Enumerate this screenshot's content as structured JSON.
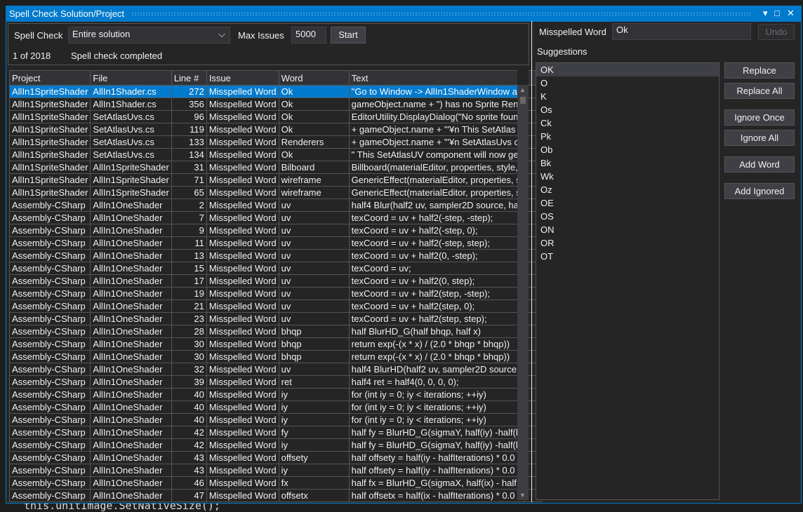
{
  "background_code": "this.unitImage.SetNativeSize();",
  "window": {
    "title": "Spell Check Solution/Project",
    "controls": {
      "dropdown": "▾",
      "maximize": "□",
      "close": "✕"
    }
  },
  "toolbar": {
    "spell_check_label": "Spell Check",
    "scope": "Entire solution",
    "max_issues_label": "Max Issues",
    "max_issues": "5000",
    "start": "Start",
    "position": "1 of 2018",
    "status": "Spell check completed"
  },
  "table": {
    "columns": [
      "Project",
      "File",
      "Line #",
      "Issue",
      "Word",
      "Text"
    ],
    "rows": [
      [
        "AllIn1SpriteShader",
        "AllIn1Shader.cs",
        "272",
        "Misspelled Word",
        "Ok",
        "\"Go to Window -> AllIn1ShaderWindow an"
      ],
      [
        "AllIn1SpriteShader",
        "AllIn1Shader.cs",
        "356",
        "Misspelled Word",
        "Ok",
        "gameObject.name + \") has no Sprite Ren"
      ],
      [
        "AllIn1SpriteShader",
        "SetAtlasUvs.cs",
        "96",
        "Misspelled Word",
        "Ok",
        "EditorUtility.DisplayDialog(\"No sprite foun"
      ],
      [
        "AllIn1SpriteShader",
        "SetAtlasUvs.cs",
        "119",
        "Misspelled Word",
        "Ok",
        "+ gameObject.name + \"'¥n This SetAtlas"
      ],
      [
        "AllIn1SpriteShader",
        "SetAtlasUvs.cs",
        "133",
        "Misspelled Word",
        "Renderers",
        "+ gameObject.name + \"'¥n SetAtlasUvs c"
      ],
      [
        "AllIn1SpriteShader",
        "SetAtlasUvs.cs",
        "134",
        "Misspelled Word",
        "Ok",
        "\" This SetAtlasUV component will now get"
      ],
      [
        "AllIn1SpriteShader",
        "AllIn1SpriteShader",
        "31",
        "Misspelled Word",
        "Bilboard",
        "Billboard(materialEditor, properties, style,"
      ],
      [
        "AllIn1SpriteShader",
        "AllIn1SpriteShader",
        "71",
        "Misspelled Word",
        "wireframe",
        "GenericEffect(materialEditor, properties, s"
      ],
      [
        "AllIn1SpriteShader",
        "AllIn1SpriteShader",
        "65",
        "Misspelled Word",
        "wireframe",
        "GenericEffect(materialEditor, properties, s"
      ],
      [
        "Assembly-CSharp",
        "AllIn1OneShader",
        "2",
        "Misspelled Word",
        "uv",
        "half4 Blur(half2 uv, sampler2D source, hal"
      ],
      [
        "Assembly-CSharp",
        "AllIn1OneShader",
        "7",
        "Misspelled Word",
        "uv",
        "texCoord = uv + half2(-step, -step);"
      ],
      [
        "Assembly-CSharp",
        "AllIn1OneShader",
        "9",
        "Misspelled Word",
        "uv",
        "texCoord = uv + half2(-step, 0);"
      ],
      [
        "Assembly-CSharp",
        "AllIn1OneShader",
        "11",
        "Misspelled Word",
        "uv",
        "texCoord = uv + half2(-step, step);"
      ],
      [
        "Assembly-CSharp",
        "AllIn1OneShader",
        "13",
        "Misspelled Word",
        "uv",
        "texCoord = uv + half2(0, -step);"
      ],
      [
        "Assembly-CSharp",
        "AllIn1OneShader",
        "15",
        "Misspelled Word",
        "uv",
        "texCoord = uv;"
      ],
      [
        "Assembly-CSharp",
        "AllIn1OneShader",
        "17",
        "Misspelled Word",
        "uv",
        "texCoord = uv + half2(0, step);"
      ],
      [
        "Assembly-CSharp",
        "AllIn1OneShader",
        "19",
        "Misspelled Word",
        "uv",
        "texCoord = uv + half2(step, -step);"
      ],
      [
        "Assembly-CSharp",
        "AllIn1OneShader",
        "21",
        "Misspelled Word",
        "uv",
        "texCoord = uv + half2(step, 0);"
      ],
      [
        "Assembly-CSharp",
        "AllIn1OneShader",
        "23",
        "Misspelled Word",
        "uv",
        "texCoord = uv + half2(step, step);"
      ],
      [
        "Assembly-CSharp",
        "AllIn1OneShader",
        "28",
        "Misspelled Word",
        "bhqp",
        "half BlurHD_G(half bhqp, half x)"
      ],
      [
        "Assembly-CSharp",
        "AllIn1OneShader",
        "30",
        "Misspelled Word",
        "bhqp",
        "return exp(-(x * x) / (2.0 * bhqp * bhqp))"
      ],
      [
        "Assembly-CSharp",
        "AllIn1OneShader",
        "30",
        "Misspelled Word",
        "bhqp",
        "return exp(-(x * x) / (2.0 * bhqp * bhqp))"
      ],
      [
        "Assembly-CSharp",
        "AllIn1OneShader",
        "32",
        "Misspelled Word",
        "uv",
        "half4 BlurHD(half2 uv, sampler2D source,"
      ],
      [
        "Assembly-CSharp",
        "AllIn1OneShader",
        "39",
        "Misspelled Word",
        "ret",
        "half4 ret = half4(0, 0, 0, 0);"
      ],
      [
        "Assembly-CSharp",
        "AllIn1OneShader",
        "40",
        "Misspelled Word",
        "iy",
        "for (int iy = 0; iy < iterations; ++iy)"
      ],
      [
        "Assembly-CSharp",
        "AllIn1OneShader",
        "40",
        "Misspelled Word",
        "iy",
        "for (int iy = 0; iy < iterations; ++iy)"
      ],
      [
        "Assembly-CSharp",
        "AllIn1OneShader",
        "40",
        "Misspelled Word",
        "iy",
        "for (int iy = 0; iy < iterations; ++iy)"
      ],
      [
        "Assembly-CSharp",
        "AllIn1OneShader",
        "42",
        "Misspelled Word",
        "fy",
        "half fy = BlurHD_G(sigmaY, half(iy) -half(l"
      ],
      [
        "Assembly-CSharp",
        "AllIn1OneShader",
        "42",
        "Misspelled Word",
        "iy",
        "half fy = BlurHD_G(sigmaY, half(iy) -half(l"
      ],
      [
        "Assembly-CSharp",
        "AllIn1OneShader",
        "43",
        "Misspelled Word",
        "offsety",
        "half offsety = half(iy - halfIterations) * 0.0"
      ],
      [
        "Assembly-CSharp",
        "AllIn1OneShader",
        "43",
        "Misspelled Word",
        "iy",
        "half offsety = half(iy - halfIterations) * 0.0"
      ],
      [
        "Assembly-CSharp",
        "AllIn1OneShader",
        "46",
        "Misspelled Word",
        "fx",
        "half fx = BlurHD_G(sigmaX, half(ix) - half"
      ],
      [
        "Assembly-CSharp",
        "AllIn1OneShader",
        "47",
        "Misspelled Word",
        "offsetx",
        "half offsetx = half(ix - halfIterations) * 0.0"
      ]
    ],
    "selected_row": 0
  },
  "right": {
    "misspelled_label": "Misspelled Word",
    "misspelled_value": "Ok",
    "undo": "Undo",
    "suggestions_label": "Suggestions",
    "suggestions": [
      "OK",
      "O",
      "K",
      "Os",
      "Ck",
      "Pk",
      "Ob",
      "Bk",
      "Wk",
      "Oz",
      "OE",
      "OS",
      "ON",
      "OR",
      "OT"
    ],
    "buttons": [
      "Replace",
      "Replace All",
      "Ignore Once",
      "Ignore All",
      "Add Word",
      "Add Ignored"
    ]
  },
  "colors": {
    "accent": "#007acc",
    "background": "#252526"
  }
}
